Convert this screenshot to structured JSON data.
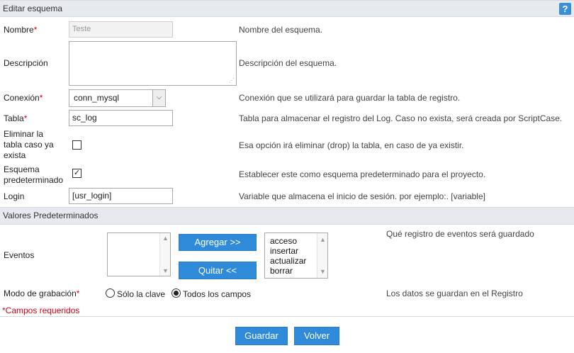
{
  "section1": {
    "title": "Editar esquema",
    "help": "?"
  },
  "fields": {
    "nombre": {
      "label": "Nombre",
      "required": "*",
      "value": "Teste",
      "desc": "Nombre del esquema."
    },
    "descripcion": {
      "label": "Descripción",
      "desc": "Descripción del esquema."
    },
    "conexion": {
      "label": "Conexión",
      "required": "*",
      "value": "conn_mysql",
      "desc": "Conexión que se utilizará para guardar la tabla de registro."
    },
    "tabla": {
      "label": "Tabla",
      "required": "*",
      "value": "sc_log",
      "desc": "Tabla para almacenar el registro del Log. Caso no exista, será creada por ScriptCase."
    },
    "eliminar": {
      "label_lines": [
        "Eliminar la",
        "tabla caso ya",
        "exista"
      ],
      "checked": false,
      "desc": "Esa opción irá eliminar (drop) la tabla, en caso de ya existir."
    },
    "esquema": {
      "label_lines": [
        "Esquema",
        "predeterminado"
      ],
      "checked": true,
      "desc": "Establecer este como esquema predeterminado para el proyecto."
    },
    "login": {
      "label": "Login",
      "value": "[usr_login]",
      "desc": "Variable que almacena el inicio de sesión. por ejemplo:. [variable]"
    }
  },
  "section2": {
    "title": "Valores Predeterminados"
  },
  "eventos": {
    "label": "Eventos",
    "add_label": "Agregar >>",
    "remove_label": "Quitar  <<",
    "available": [
      "acceso",
      "insertar",
      "actualizar",
      "borrar"
    ],
    "desc": "Qué registro de eventos será guardado"
  },
  "modo": {
    "label": "Modo de grabación",
    "required": "*",
    "options": [
      "Sólo la clave",
      "Todos los campos"
    ],
    "selected": "Todos los campos",
    "desc": "Los datos se guardan en el Registro"
  },
  "required_note": "*Campos requeridos",
  "actions": {
    "save_label": "Guardar",
    "back_label": "Volver"
  }
}
